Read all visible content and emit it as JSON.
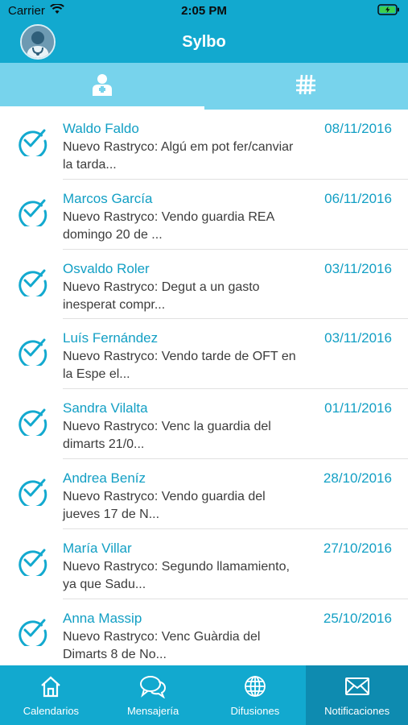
{
  "status_bar": {
    "carrier": "Carrier",
    "time": "2:05 PM",
    "icons": [
      "wifi-icon",
      "battery-charging-icon"
    ]
  },
  "nav_bar": {
    "title": "Sylbo",
    "avatar_icon": "doctor-avatar-icon"
  },
  "top_tabs": [
    {
      "icon": "doctor-person-icon",
      "active": true
    },
    {
      "icon": "hashtag-grid-icon",
      "active": false
    }
  ],
  "notifications": [
    {
      "name": "Waldo Faldo",
      "date": "08/11/2016",
      "line1": "Nuevo Rastryco: Algú em pot fer/canviar",
      "line2": "la tarda..."
    },
    {
      "name": "Marcos García",
      "date": "06/11/2016",
      "line1": "Nuevo Rastryco: Vendo guardia REA",
      "line2": "domingo 20 de ..."
    },
    {
      "name": "Osvaldo Roler",
      "date": "03/11/2016",
      "line1": "Nuevo Rastryco: Degut a un gasto",
      "line2": "inesperat compr..."
    },
    {
      "name": "Luís Fernández",
      "date": "03/11/2016",
      "line1": "Nuevo Rastryco: Vendo tarde de OFT en",
      "line2": "la Espe el..."
    },
    {
      "name": "Sandra Vilalta",
      "date": "01/11/2016",
      "line1": "Nuevo Rastryco: Venc la guardia del",
      "line2": "dimarts 21/0..."
    },
    {
      "name": "Andrea Beníz",
      "date": "28/10/2016",
      "line1": "Nuevo Rastryco: Vendo guardia del",
      "line2": "jueves 17 de N..."
    },
    {
      "name": "María Villar",
      "date": "27/10/2016",
      "line1": "Nuevo Rastryco: Segundo llamamiento,",
      "line2": "ya que Sadu..."
    },
    {
      "name": "Anna Massip",
      "date": "25/10/2016",
      "line1": "Nuevo Rastryco: Venc Guàrdia del",
      "line2": "Dimarts 8 de No..."
    }
  ],
  "bottom_tabs": [
    {
      "label": "Calendarios",
      "icon": "home-icon",
      "active": false
    },
    {
      "label": "Mensajería",
      "icon": "chat-bubbles-icon",
      "active": false
    },
    {
      "label": "Difusiones",
      "icon": "globe-icon",
      "active": false
    },
    {
      "label": "Notificaciones",
      "icon": "envelope-icon",
      "active": true
    }
  ],
  "colors": {
    "primary": "#12a9cf",
    "tab_strip": "#77d3ec",
    "accent_text": "#129fc4",
    "active_bottom_tab": "#0e8bb0"
  }
}
